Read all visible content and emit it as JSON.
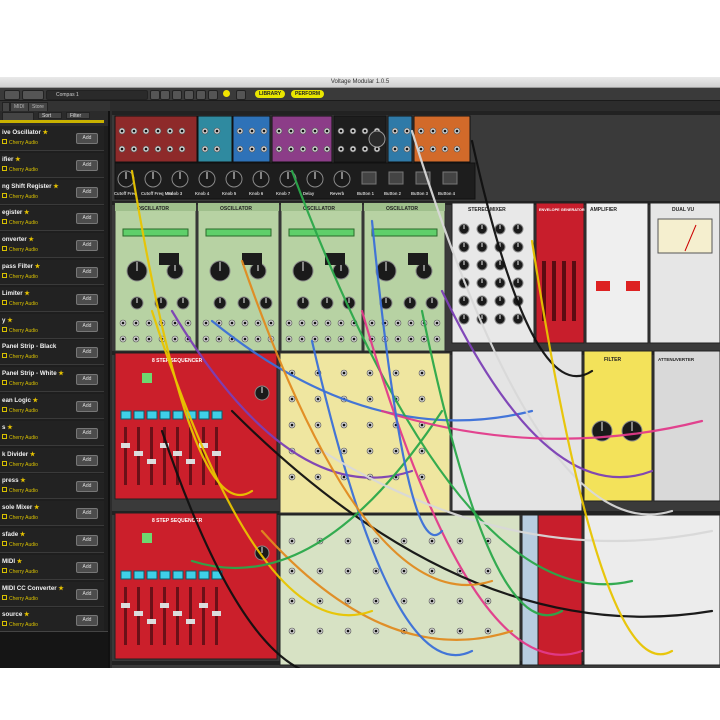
{
  "window": {
    "title": "Voltage Modular 1.0.5",
    "toolbar": {
      "preset": "Compas 1",
      "library_label": "LIBRARY",
      "perform_label": "PERFORM"
    },
    "tabs": [
      "MIDI",
      "Store"
    ]
  },
  "sidebar": {
    "sort_label": "Sort",
    "filter_label": "Filter",
    "items": [
      {
        "name": "ive Oscillator",
        "starred": true,
        "author": "Cherry Audio",
        "button": "Add"
      },
      {
        "name": "ifier",
        "starred": true,
        "author": "Cherry Audio",
        "button": "Add"
      },
      {
        "name": "ng Shift Register",
        "starred": true,
        "author": "Cherry Audio",
        "button": "Add"
      },
      {
        "name": "egister",
        "starred": true,
        "author": "Cherry Audio",
        "button": "Add"
      },
      {
        "name": "onverter",
        "starred": true,
        "author": "Cherry Audio",
        "button": "Add"
      },
      {
        "name": "pass Filter",
        "starred": true,
        "author": "Cherry Audio",
        "button": "Add"
      },
      {
        "name": "Limiter",
        "starred": true,
        "author": "Cherry Audio",
        "button": "Add"
      },
      {
        "name": "y",
        "starred": true,
        "author": "Cherry Audio",
        "button": "Add"
      },
      {
        "name": "Panel Strip - Black",
        "starred": false,
        "author": "Cherry Audio",
        "button": "Add"
      },
      {
        "name": "Panel Strip - White",
        "starred": true,
        "author": "Cherry Audio",
        "button": "Add"
      },
      {
        "name": "ean Logic",
        "starred": true,
        "author": "Cherry Audio",
        "button": "Add"
      },
      {
        "name": "s",
        "starred": true,
        "author": "Cherry Audio",
        "button": "Add"
      },
      {
        "name": "k Divider",
        "starred": true,
        "author": "Cherry Audio",
        "button": "Add"
      },
      {
        "name": "press",
        "starred": true,
        "author": "Cherry Audio",
        "button": "Add"
      },
      {
        "name": "sole Mixer",
        "starred": true,
        "author": "Cherry Audio",
        "button": "Add"
      },
      {
        "name": "sfade",
        "starred": true,
        "author": "Cherry Audio",
        "button": "Add"
      },
      {
        "name": "MIDI",
        "starred": true,
        "author": "Cherry Audio",
        "button": "Add"
      },
      {
        "name": "MIDI CC Converter",
        "starred": true,
        "author": "Cherry Audio",
        "button": "Add"
      },
      {
        "name": "source",
        "starred": true,
        "author": "Cherry Audio",
        "button": "Add"
      }
    ]
  },
  "rack": {
    "macro_knobs": [
      "Cutoff Freq",
      "Cutoff Freq Mod",
      "Knob 3",
      "Knob 4",
      "Knob 5",
      "Knob 6",
      "Knob 7",
      "Delay",
      "Reverb",
      "Button 1",
      "Button 2",
      "Button 3",
      "Button 4"
    ],
    "modules": {
      "oscillator": "OSCILLATOR",
      "step_sequencer": "8 STEP SEQUENCER",
      "stereo_mixer": "STEREO MIXER",
      "envelope": "ENVELOPE GENERATOR",
      "amplifier": "AMPLIFIER",
      "dual_vu": "DUAL VU",
      "filter": "FILTER",
      "attenuverter": "ATTENUVERTER"
    }
  },
  "colors": {
    "osc_panel": "#b7d2a3",
    "seq_panel": "#cb1f2b",
    "yellow_panel": "#efe6a0",
    "cable_palette": [
      "#e8c400",
      "#7b3fb5",
      "#3a6fd8",
      "#2aa84a",
      "#e23a8a",
      "#101010",
      "#d8d8d8",
      "#e08a20"
    ]
  }
}
